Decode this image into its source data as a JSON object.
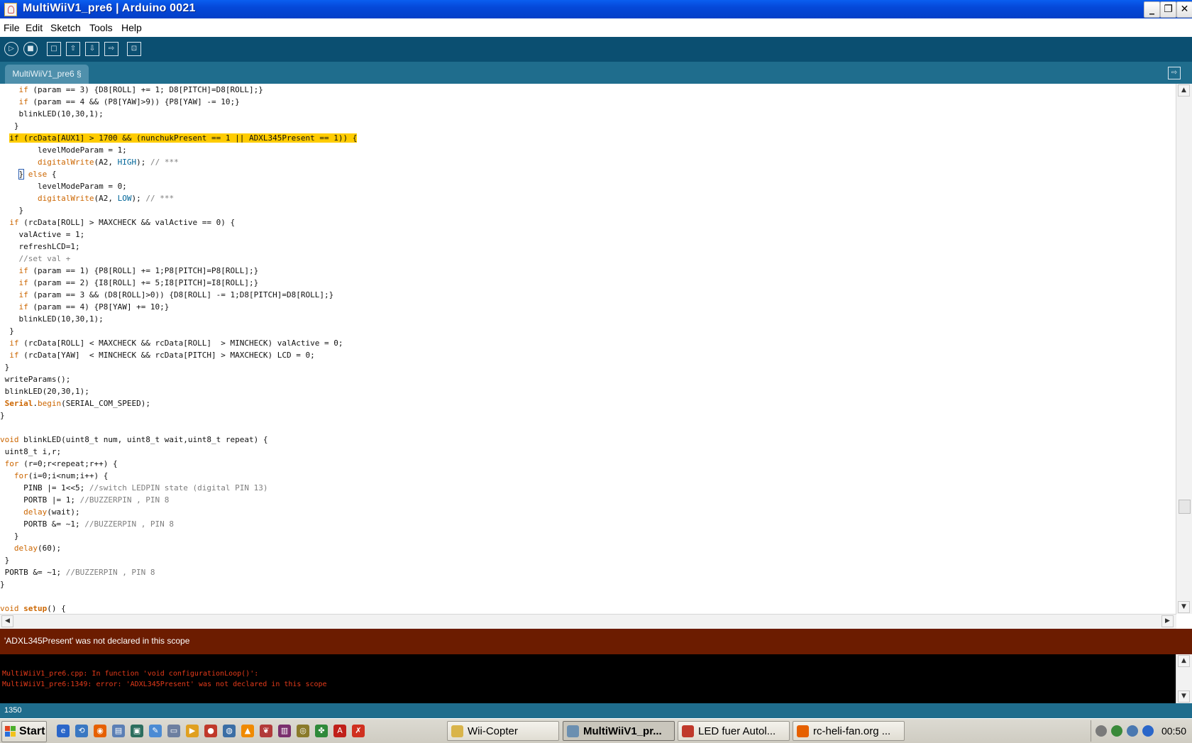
{
  "window": {
    "title": "MultiWiiV1_pre6 | Arduino 0021",
    "controls": {
      "minimize": "_",
      "maximize": "❐",
      "close": "✕"
    }
  },
  "menu": [
    "File",
    "Edit",
    "Sketch",
    "Tools",
    "Help"
  ],
  "toolbar": {
    "buttons": [
      {
        "name": "verify-button",
        "icon": "▷"
      },
      {
        "name": "stop-button",
        "icon": "■"
      },
      {
        "name": "new-button",
        "icon": "□"
      },
      {
        "name": "open-button",
        "icon": "⇧"
      },
      {
        "name": "save-button",
        "icon": "⇩"
      },
      {
        "name": "upload-button",
        "icon": "⇨"
      },
      {
        "name": "serial-monitor-button",
        "icon": "⊡"
      }
    ]
  },
  "tab": {
    "label": "MultiWiiV1_pre6 §",
    "menu_icon": "⇨"
  },
  "editor": {
    "highlighted_line_index": 4,
    "lines": [
      "    if (param == 3) {D8[ROLL] += 1; D8[PITCH]=D8[ROLL];}",
      "    if (param == 4 && (P8[YAW]>9)) {P8[YAW] -= 10;}",
      "    blinkLED(10,30,1);",
      "   }",
      "  if (rcData[AUX1] > 1700 && (nunchukPresent == 1 || ADXL345Present == 1)) {",
      "        levelModeParam = 1;",
      "        digitalWrite(A2, HIGH); // ***",
      "    } else {",
      "        levelModeParam = 0;",
      "        digitalWrite(A2, LOW); // ***",
      "    }",
      "  if (rcData[ROLL] > MAXCHECK && valActive == 0) {",
      "    valActive = 1;",
      "    refreshLCD=1;",
      "    //set val +",
      "    if (param == 1) {P8[ROLL] += 1;P8[PITCH]=P8[ROLL];}",
      "    if (param == 2) {I8[ROLL] += 5;I8[PITCH]=I8[ROLL];}",
      "    if (param == 3 && (D8[ROLL]>0)) {D8[ROLL] -= 1;D8[PITCH]=D8[ROLL];}",
      "    if (param == 4) {P8[YAW] += 10;}",
      "    blinkLED(10,30,1);",
      "  }",
      "  if (rcData[ROLL] < MAXCHECK && rcData[ROLL]  > MINCHECK) valActive = 0;",
      "  if (rcData[YAW]  < MINCHECK && rcData[PITCH] > MAXCHECK) LCD = 0;",
      " }",
      " writeParams();",
      " blinkLED(20,30,1);",
      " Serial.begin(SERIAL_COM_SPEED);",
      "}",
      "",
      "void blinkLED(uint8_t num, uint8_t wait,uint8_t repeat) {",
      " uint8_t i,r;",
      " for (r=0;r<repeat;r++) {",
      "   for(i=0;i<num;i++) {",
      "     PINB |= 1<<5; //switch LEDPIN state (digital PIN 13)",
      "     PORTB |= 1; //BUZZERPIN , PIN 8",
      "     delay(wait);",
      "     PORTB &= ~1; //BUZZERPIN , PIN 8",
      "   }",
      "   delay(60);",
      " }",
      " PORTB &= ~1; //BUZZERPIN , PIN 8",
      "}",
      "",
      "void setup() {"
    ]
  },
  "status": {
    "message": "'ADXL345Present' was not declared in this scope"
  },
  "console": {
    "lines": [
      "MultiWiiV1_pre6.cpp: In function 'void configurationLoop()':",
      "MultiWiiV1_pre6:1349: error: 'ADXL345Present' was not declared in this scope"
    ]
  },
  "line_number": "1350",
  "taskbar": {
    "start_label": "Start",
    "quick_launch": [
      {
        "name": "ie-icon",
        "color": "#2a66c9",
        "glyph": "e"
      },
      {
        "name": "network-icon",
        "color": "#3a78c2",
        "glyph": "⟲"
      },
      {
        "name": "firefox-icon",
        "color": "#e66000",
        "glyph": "◉"
      },
      {
        "name": "notepad-icon",
        "color": "#5b7fb5",
        "glyph": "▤"
      },
      {
        "name": "monitor-icon",
        "color": "#2c6e5e",
        "glyph": "▣"
      },
      {
        "name": "editor-icon",
        "color": "#4b8bd4",
        "glyph": "✎"
      },
      {
        "name": "folder-icon",
        "color": "#6d7fa0",
        "glyph": "▭"
      },
      {
        "name": "media-player-icon",
        "color": "#e0a020",
        "glyph": "▶"
      },
      {
        "name": "app-icon",
        "color": "#c0392b",
        "glyph": "●"
      },
      {
        "name": "chat-icon",
        "color": "#3b6ea5",
        "glyph": "◍"
      },
      {
        "name": "vlc-icon",
        "color": "#f08a00",
        "glyph": "▲"
      },
      {
        "name": "butterfly-icon",
        "color": "#b23a3a",
        "glyph": "❦"
      },
      {
        "name": "winrar-icon",
        "color": "#7a2f6e",
        "glyph": "▥"
      },
      {
        "name": "utility-icon",
        "color": "#8a7a2a",
        "glyph": "◎"
      },
      {
        "name": "clover-icon",
        "color": "#2f8a3a",
        "glyph": "✤"
      },
      {
        "name": "pdf-icon",
        "color": "#c0201a",
        "glyph": "A"
      },
      {
        "name": "tool-icon",
        "color": "#d03020",
        "glyph": "✗"
      }
    ],
    "tasks": [
      {
        "label": "Wii-Copter",
        "color": "#d9b44a",
        "active": false
      },
      {
        "label": "MultiWiiV1_pr...",
        "color": "#6b8fb0",
        "active": true
      },
      {
        "label": "LED fuer Autol...",
        "color": "#c0392b",
        "active": false
      },
      {
        "label": "rc-heli-fan.org ...",
        "color": "#e66000",
        "active": false
      }
    ],
    "tray_icons": [
      {
        "name": "speaker-icon",
        "color": "#7a7a7a"
      },
      {
        "name": "tray-app-icon",
        "color": "#3a8a3a"
      },
      {
        "name": "network-tray-icon",
        "color": "#4a78b0"
      },
      {
        "name": "info-icon",
        "color": "#2a66c9"
      }
    ],
    "clock": "00:50"
  }
}
